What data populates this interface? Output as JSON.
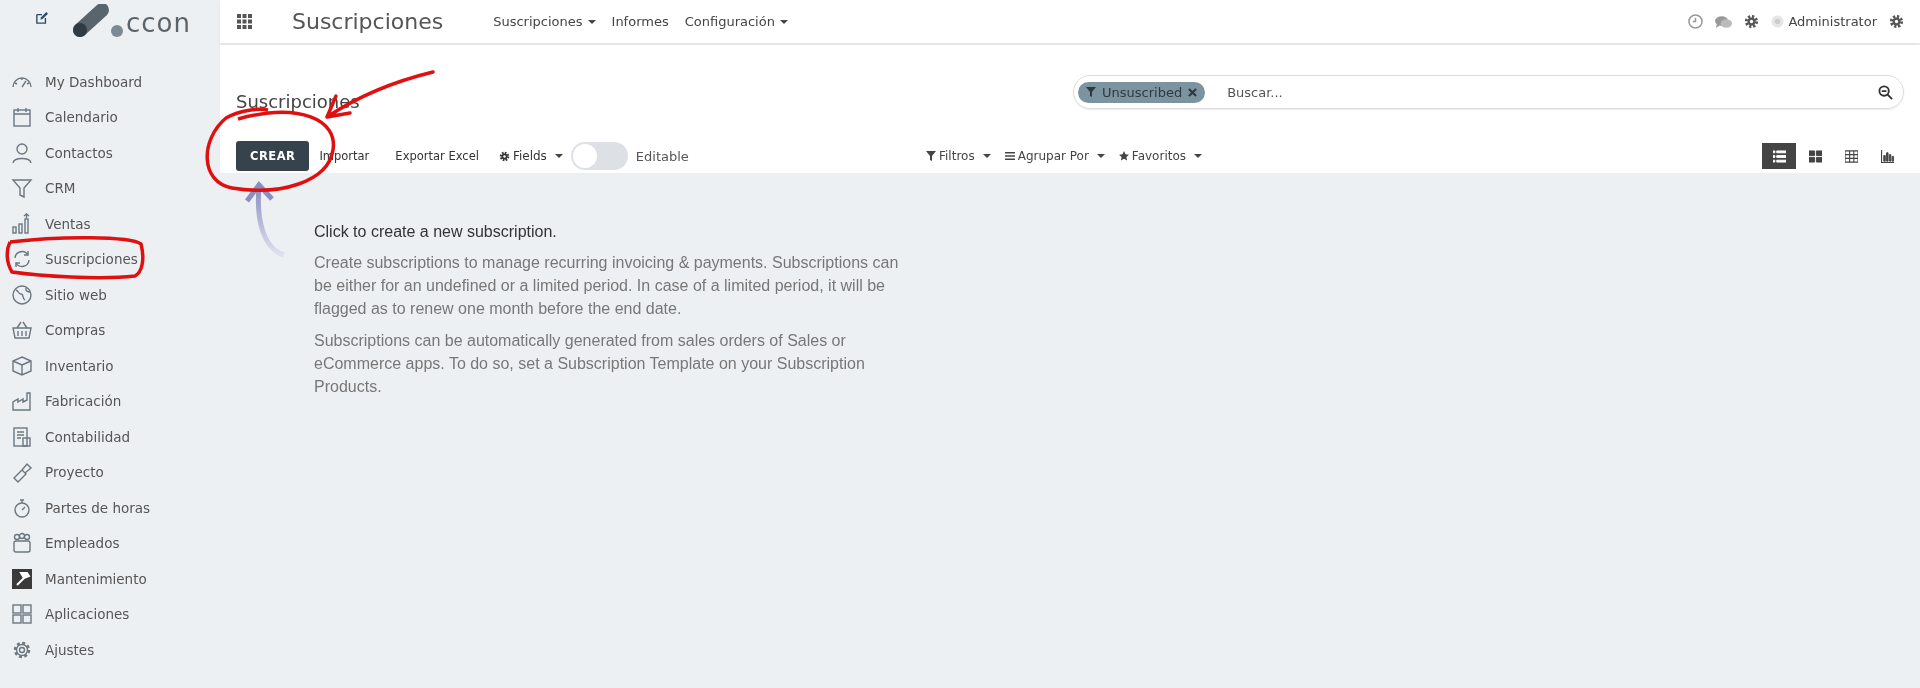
{
  "sidebar": {
    "logo": "ccon",
    "items": [
      {
        "label": "My Dashboard"
      },
      {
        "label": "Calendario"
      },
      {
        "label": "Contactos"
      },
      {
        "label": "CRM"
      },
      {
        "label": "Ventas"
      },
      {
        "label": "Suscripciones"
      },
      {
        "label": "Sitio web"
      },
      {
        "label": "Compras"
      },
      {
        "label": "Inventario"
      },
      {
        "label": "Fabricación"
      },
      {
        "label": "Contabilidad"
      },
      {
        "label": "Proyecto"
      },
      {
        "label": "Partes de horas"
      },
      {
        "label": "Empleados"
      },
      {
        "label": "Mantenimiento"
      },
      {
        "label": "Aplicaciones"
      },
      {
        "label": "Ajustes"
      }
    ]
  },
  "topbar": {
    "app_title": "Suscripciones",
    "menus": [
      {
        "label": "Suscripciones",
        "dropdown": true
      },
      {
        "label": "Informes",
        "dropdown": false
      },
      {
        "label": "Configuración",
        "dropdown": true
      }
    ],
    "user": "Administrator"
  },
  "control_panel": {
    "breadcrumb": "Suscripciones",
    "search": {
      "facets": [
        {
          "label": "Unsuscribed"
        }
      ],
      "placeholder": "Buscar..."
    },
    "actions": [
      {
        "kind": "primary",
        "label": "CREAR"
      },
      {
        "kind": "link",
        "label": "Importar"
      },
      {
        "kind": "link",
        "label": "Exportar Excel"
      },
      {
        "kind": "fields",
        "label": "Fields"
      }
    ],
    "editable_toggle": {
      "label": "Editable",
      "on": false
    },
    "filters": [
      {
        "kind": "filter",
        "label": "Filtros"
      },
      {
        "kind": "group",
        "label": "Agrupar Por"
      },
      {
        "kind": "star",
        "label": "Favoritos"
      }
    ],
    "views": [
      {
        "kind": "list",
        "selected": true
      },
      {
        "kind": "kanban",
        "selected": false
      },
      {
        "kind": "pivot",
        "selected": false
      },
      {
        "kind": "graph",
        "selected": false
      }
    ]
  },
  "help": {
    "title": "Click to create a new subscription.",
    "paragraphs": [
      "Create subscriptions to manage recurring invoicing & payments. Subscriptions can be either for an undefined or a limited period. In case of a limited period, it will be flagged as to renew one month before the end date.",
      "Subscriptions can be automatically generated from sales orders of Sales or eCommerce apps. To do so, set a Subscription Template on your Subscription Products."
    ]
  }
}
